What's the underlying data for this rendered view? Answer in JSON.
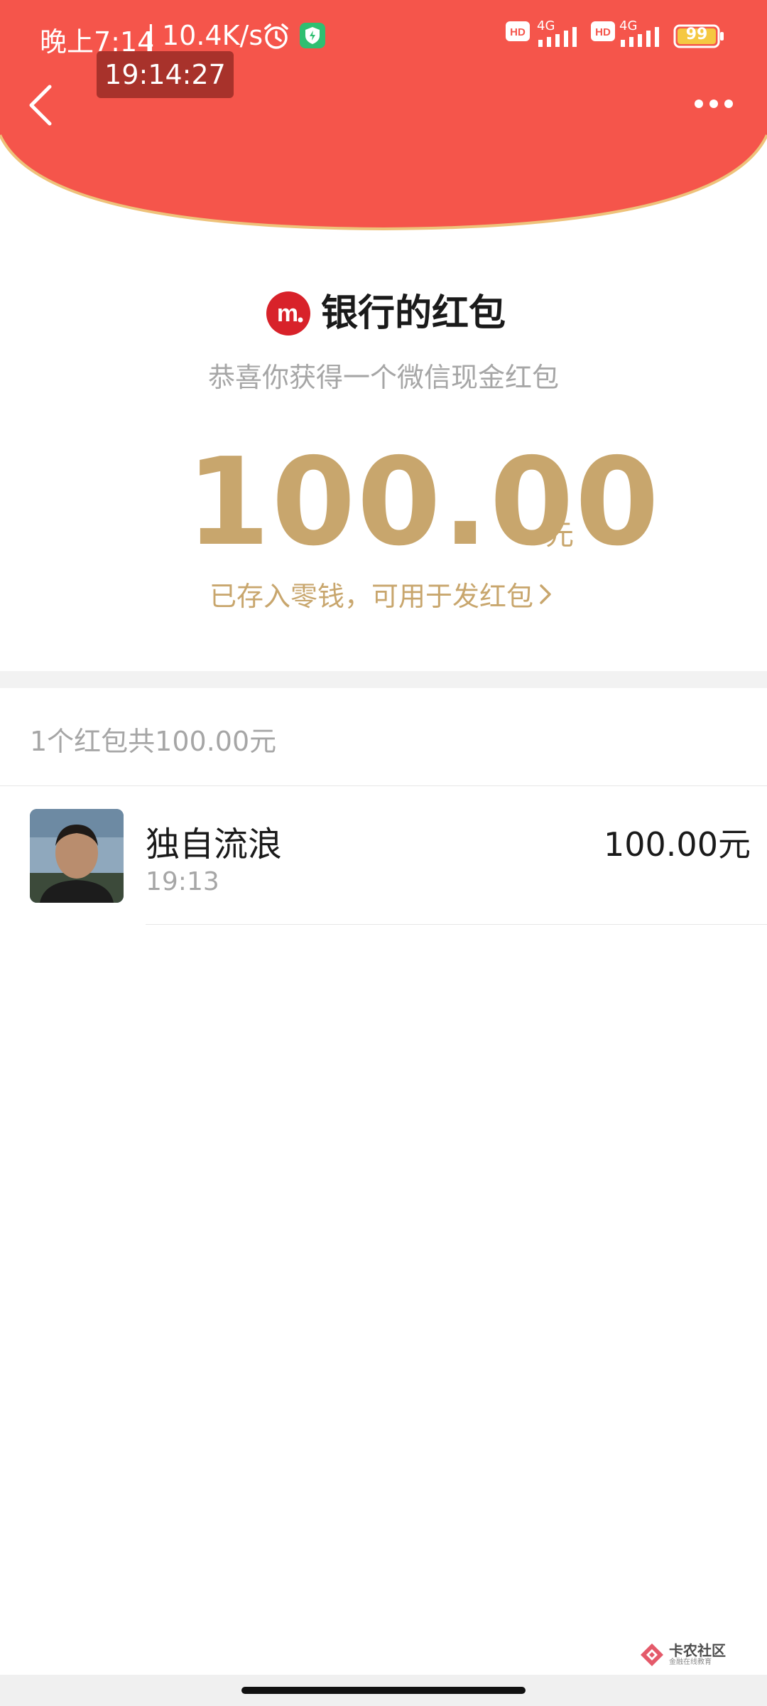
{
  "status_bar": {
    "time": "晚上7:14",
    "separator": "|",
    "net_speed": "10.4K/s",
    "net1": "4G",
    "net2": "4G",
    "battery": "99"
  },
  "clock_overlay": "19:14:27",
  "red_packet": {
    "sender_name": "银行的红包",
    "greeting": "恭喜你获得一个微信现金红包",
    "amount": "100.00",
    "amount_unit": "元",
    "saved_note": "已存入零钱，可用于发红包"
  },
  "summary": "1个红包共100.00元",
  "receivers": [
    {
      "name": "独自流浪",
      "time": "19:13",
      "amount": "100.00元"
    }
  ],
  "watermark": {
    "title": "卡农社区",
    "subtitle": "金融在线教育"
  },
  "colors": {
    "header_red": "#F5554B",
    "header_arc_border": "#EEC27A",
    "gold": "#C8A66D",
    "gray_text": "#A6A6A6"
  }
}
